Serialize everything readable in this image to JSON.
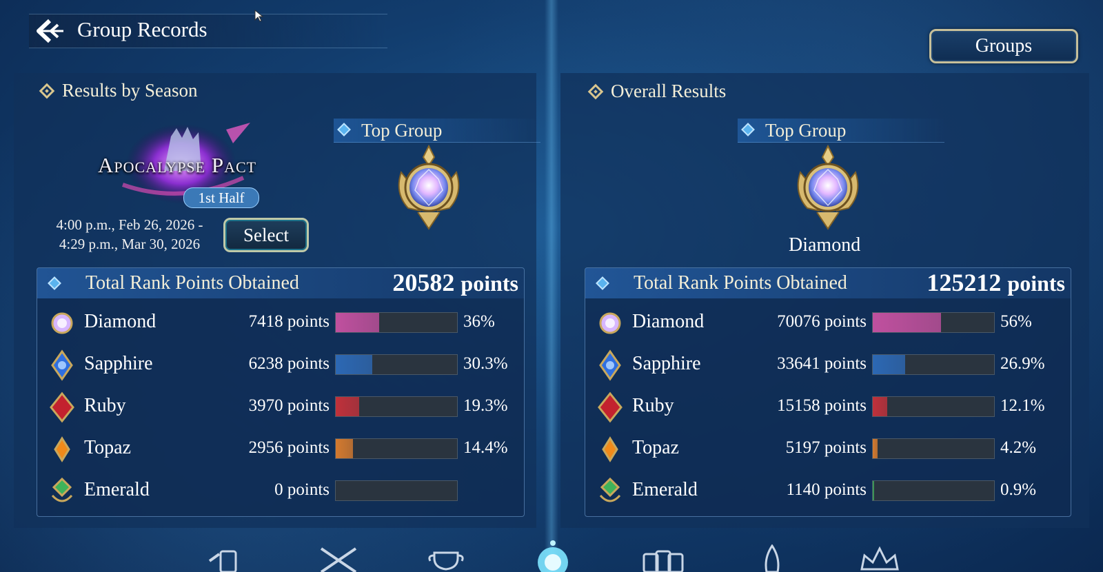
{
  "header": {
    "title": "Group Records",
    "groups_label": "Groups"
  },
  "season_panel": {
    "section_title": "Results by Season",
    "season_logo": {
      "name": "Apocalypse Pact",
      "badge": "1st Half"
    },
    "date_line1": "4:00 p.m., Feb 26, 2026 -",
    "date_line2": "4:29 p.m., Mar 30, 2026",
    "select_label": "Select",
    "top_group_label": "Top Group",
    "total_label": "Total Rank Points Obtained",
    "total_value": "20582",
    "total_unit": "points",
    "rows": [
      {
        "name": "Diamond",
        "points": "7418 points",
        "percent": "36%",
        "fraction": 0.36,
        "color": "#c0509f"
      },
      {
        "name": "Sapphire",
        "points": "6238 points",
        "percent": "30.3%",
        "fraction": 0.303,
        "color": "#2c68b4"
      },
      {
        "name": "Ruby",
        "points": "3970 points",
        "percent": "19.3%",
        "fraction": 0.193,
        "color": "#c0313b"
      },
      {
        "name": "Topaz",
        "points": "2956 points",
        "percent": "14.4%",
        "fraction": 0.144,
        "color": "#d47a2f"
      },
      {
        "name": "Emerald",
        "points": "0 points",
        "percent": "",
        "fraction": 0,
        "color": "#3fa05a"
      }
    ]
  },
  "overall_panel": {
    "section_title": "Overall Results",
    "top_group_label": "Top Group",
    "top_group_rank": "Diamond",
    "total_label": "Total Rank Points Obtained",
    "total_value": "125212",
    "total_unit": "points",
    "rows": [
      {
        "name": "Diamond",
        "points": "70076 points",
        "percent": "56%",
        "fraction": 0.56,
        "color": "#c0509f"
      },
      {
        "name": "Sapphire",
        "points": "33641 points",
        "percent": "26.9%",
        "fraction": 0.269,
        "color": "#2c68b4"
      },
      {
        "name": "Ruby",
        "points": "15158 points",
        "percent": "12.1%",
        "fraction": 0.121,
        "color": "#c0313b"
      },
      {
        "name": "Topaz",
        "points": "5197 points",
        "percent": "4.2%",
        "fraction": 0.042,
        "color": "#d47a2f"
      },
      {
        "name": "Emerald",
        "points": "1140 points",
        "percent": "0.9%",
        "fraction": 0.009,
        "color": "#3fa05a"
      }
    ]
  },
  "icons": {
    "back": "back-arrow-icon",
    "bottom_nav": [
      "cards-icon",
      "crossed-swords-icon",
      "trophy-icon",
      "crystal-icon",
      "card-deck-icon",
      "spire-icon",
      "crown-icon"
    ]
  },
  "colors": {
    "accent_gold": "#d9c68e",
    "panel_bg": "#10305a"
  }
}
